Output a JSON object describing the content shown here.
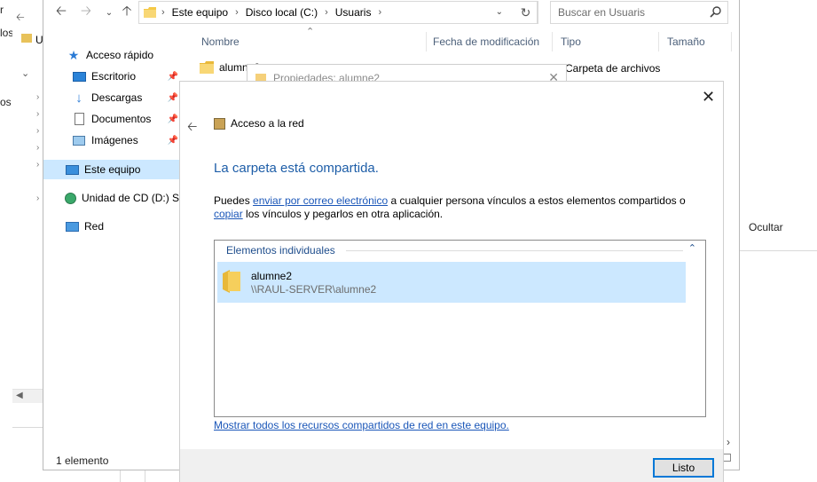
{
  "background": {
    "left_text_1": "r",
    "left_text_2": "los",
    "left_text_3": "os",
    "tree_label": "U",
    "hide_label": "Ocultar"
  },
  "explorer": {
    "breadcrumb": [
      "Este equipo",
      "Disco local (C:)",
      "Usuaris"
    ],
    "search_placeholder": "Buscar en Usuaris",
    "nav": {
      "quick_access": "Acceso rápido",
      "pinned": [
        "Escritorio",
        "Descargas",
        "Documentos",
        "Imágenes"
      ],
      "this_pc": "Este equipo",
      "cd_drive": "Unidad de CD (D:) SS",
      "network": "Red"
    },
    "columns": [
      "Nombre",
      "Fecha de modificación",
      "Tipo",
      "Tamaño"
    ],
    "file": {
      "name": "alumne2",
      "type": "Carpeta de archivos"
    },
    "status": "1 elemento"
  },
  "dialog": {
    "background_title": "Propiedades: alumne2",
    "breadcrumb_title": "Acceso a la red",
    "heading": "La carpeta está compartida.",
    "desc_1": "Puedes ",
    "link_email": "enviar por correo electrónico",
    "desc_2": " a cualquier persona vínculos a estos elementos compartidos o ",
    "link_copy": "copiar",
    "desc_3": " los vínculos y pegarlos en otra aplicación.",
    "group_header": "Elementos individuales",
    "item": {
      "name": "alumne2",
      "path": "\\\\RAUL-SERVER\\alumne2"
    },
    "show_all_link": "Mostrar todos los recursos compartidos de red en este equipo.",
    "ok_label": "Listo"
  },
  "colors": {
    "accent": "#1e5ea8",
    "link": "#1a56b8",
    "selection": "#cce8ff"
  }
}
